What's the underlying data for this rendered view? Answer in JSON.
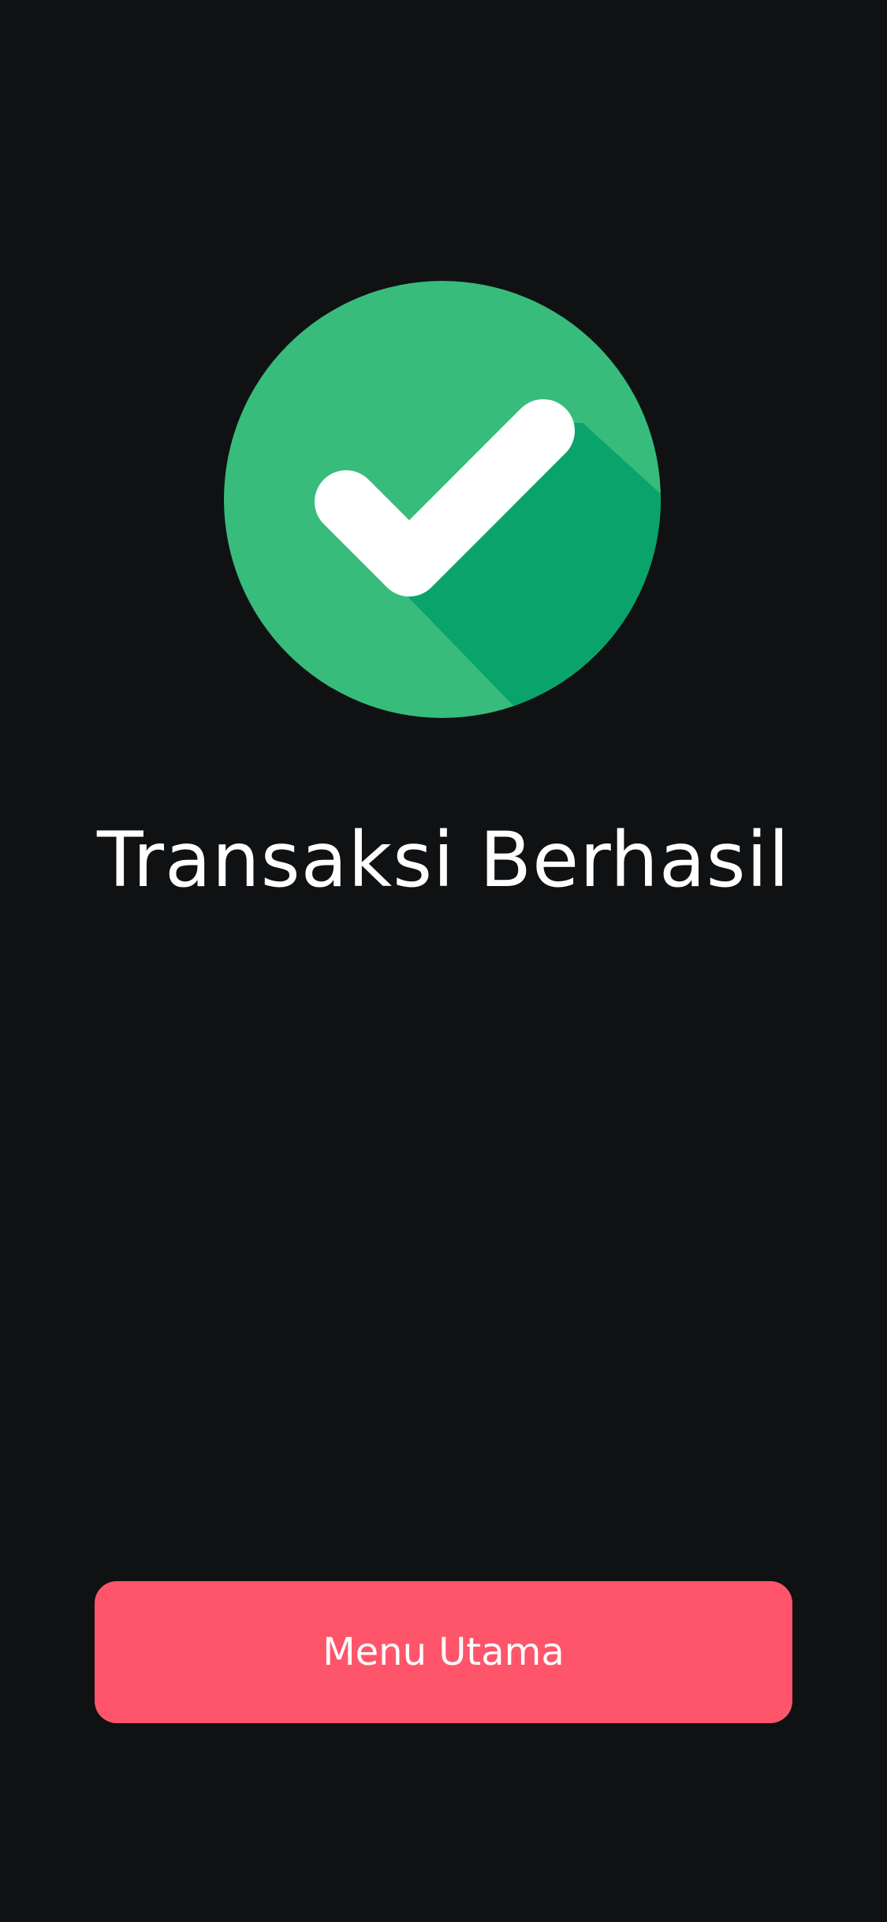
{
  "success": {
    "icon": "check-circle-icon",
    "title": "Transaksi Berhasil",
    "circle_color": "#37bc7c",
    "shadow_color": "#0ba36c",
    "check_color": "#ffffff"
  },
  "actions": {
    "main_menu_label": "Menu Utama",
    "button_color": "#ff556b"
  },
  "theme": {
    "background": "#101113",
    "text_color": "#ffffff"
  }
}
